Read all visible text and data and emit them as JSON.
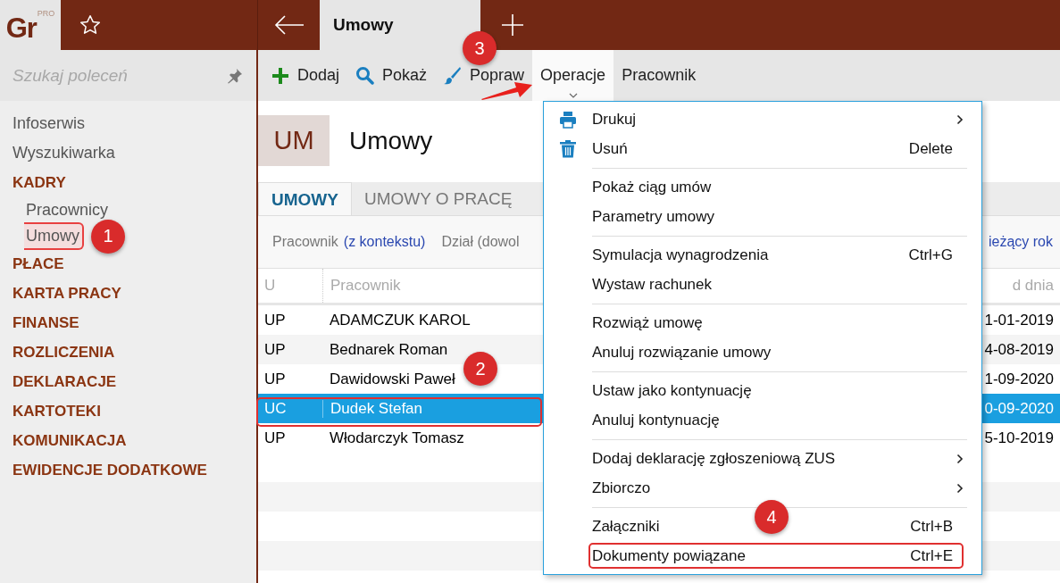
{
  "app": {
    "logo": "Gr",
    "logo_badge": "PRO"
  },
  "tabs": [
    {
      "label": "Umowy",
      "selected": true
    }
  ],
  "search": {
    "placeholder": "Szukaj poleceń"
  },
  "sidebar": {
    "items": [
      {
        "label": "Infoserwis",
        "kind": "link"
      },
      {
        "label": "Wyszukiwarka",
        "kind": "link"
      },
      {
        "label": "KADRY",
        "kind": "section",
        "children": [
          {
            "label": "Pracownicy",
            "selected": false
          },
          {
            "label": "Umowy",
            "selected": true,
            "callout": "1"
          }
        ]
      },
      {
        "label": "PŁACE",
        "kind": "section"
      },
      {
        "label": "KARTA PRACY",
        "kind": "section"
      },
      {
        "label": "FINANSE",
        "kind": "section"
      },
      {
        "label": "ROZLICZENIA",
        "kind": "section"
      },
      {
        "label": "DEKLARACJE",
        "kind": "section"
      },
      {
        "label": "KARTOTEKI",
        "kind": "section"
      },
      {
        "label": "KOMUNIKACJA",
        "kind": "section"
      },
      {
        "label": "EWIDENCJE DODATKOWE",
        "kind": "section"
      }
    ]
  },
  "toolbar": [
    {
      "label": "Dodaj",
      "selected": false
    },
    {
      "label": "Pokaż",
      "selected": false
    },
    {
      "label": "Popraw",
      "selected": false
    },
    {
      "label": "Operacje",
      "selected": true,
      "callout": "3"
    },
    {
      "label": "Pracownik",
      "selected": false
    }
  ],
  "page": {
    "badge": "UM",
    "title": "Umowy"
  },
  "subtabs": [
    {
      "label": "UMOWY",
      "selected": true
    },
    {
      "label": "UMOWY O PRACĘ",
      "selected": false
    }
  ],
  "filters": {
    "employee_label": "Pracownik",
    "employee_value": "(z kontekstu)",
    "department": "Dział (dowol",
    "period": "ieżący rok"
  },
  "table": {
    "columns": [
      "U",
      "Pracownik",
      "d dnia"
    ],
    "rows": [
      {
        "cells": [
          "UP",
          "ADAMCZUK KAROL",
          "1-01-2019"
        ],
        "selected": false
      },
      {
        "cells": [
          "UP",
          "Bednarek Roman",
          "4-08-2019"
        ],
        "selected": false
      },
      {
        "cells": [
          "UP",
          "Dawidowski Paweł",
          "1-09-2020"
        ],
        "selected": false,
        "callout": "2"
      },
      {
        "cells": [
          "UC",
          "Dudek Stefan",
          "0-09-2020"
        ],
        "selected": true
      },
      {
        "cells": [
          "UP",
          "Włodarczyk Tomasz",
          "5-10-2019"
        ],
        "selected": false
      }
    ]
  },
  "menu": {
    "groups": [
      [
        {
          "label": "Drukuj",
          "submenu": true
        },
        {
          "label": "Usuń",
          "shortcut": "Delete"
        }
      ],
      [
        {
          "label": "Pokaż ciąg umów"
        },
        {
          "label": "Parametry umowy"
        }
      ],
      [
        {
          "label": "Symulacja wynagrodzenia",
          "shortcut": "Ctrl+G"
        },
        {
          "label": "Wystaw rachunek"
        }
      ],
      [
        {
          "label": "Rozwiąż umowę"
        },
        {
          "label": "Anuluj rozwiązanie umowy"
        }
      ],
      [
        {
          "label": "Ustaw jako kontynuację"
        },
        {
          "label": "Anuluj kontynuację"
        }
      ],
      [
        {
          "label": "Dodaj deklarację zgłoszeniową ZUS",
          "submenu": true
        },
        {
          "label": "Zbiorczo",
          "submenu": true
        }
      ],
      [
        {
          "label": "Załączniki",
          "shortcut": "Ctrl+B",
          "callout": "4"
        },
        {
          "label": "Dokumenty powiązane",
          "shortcut": "Ctrl+E",
          "outlined": true
        }
      ]
    ]
  }
}
